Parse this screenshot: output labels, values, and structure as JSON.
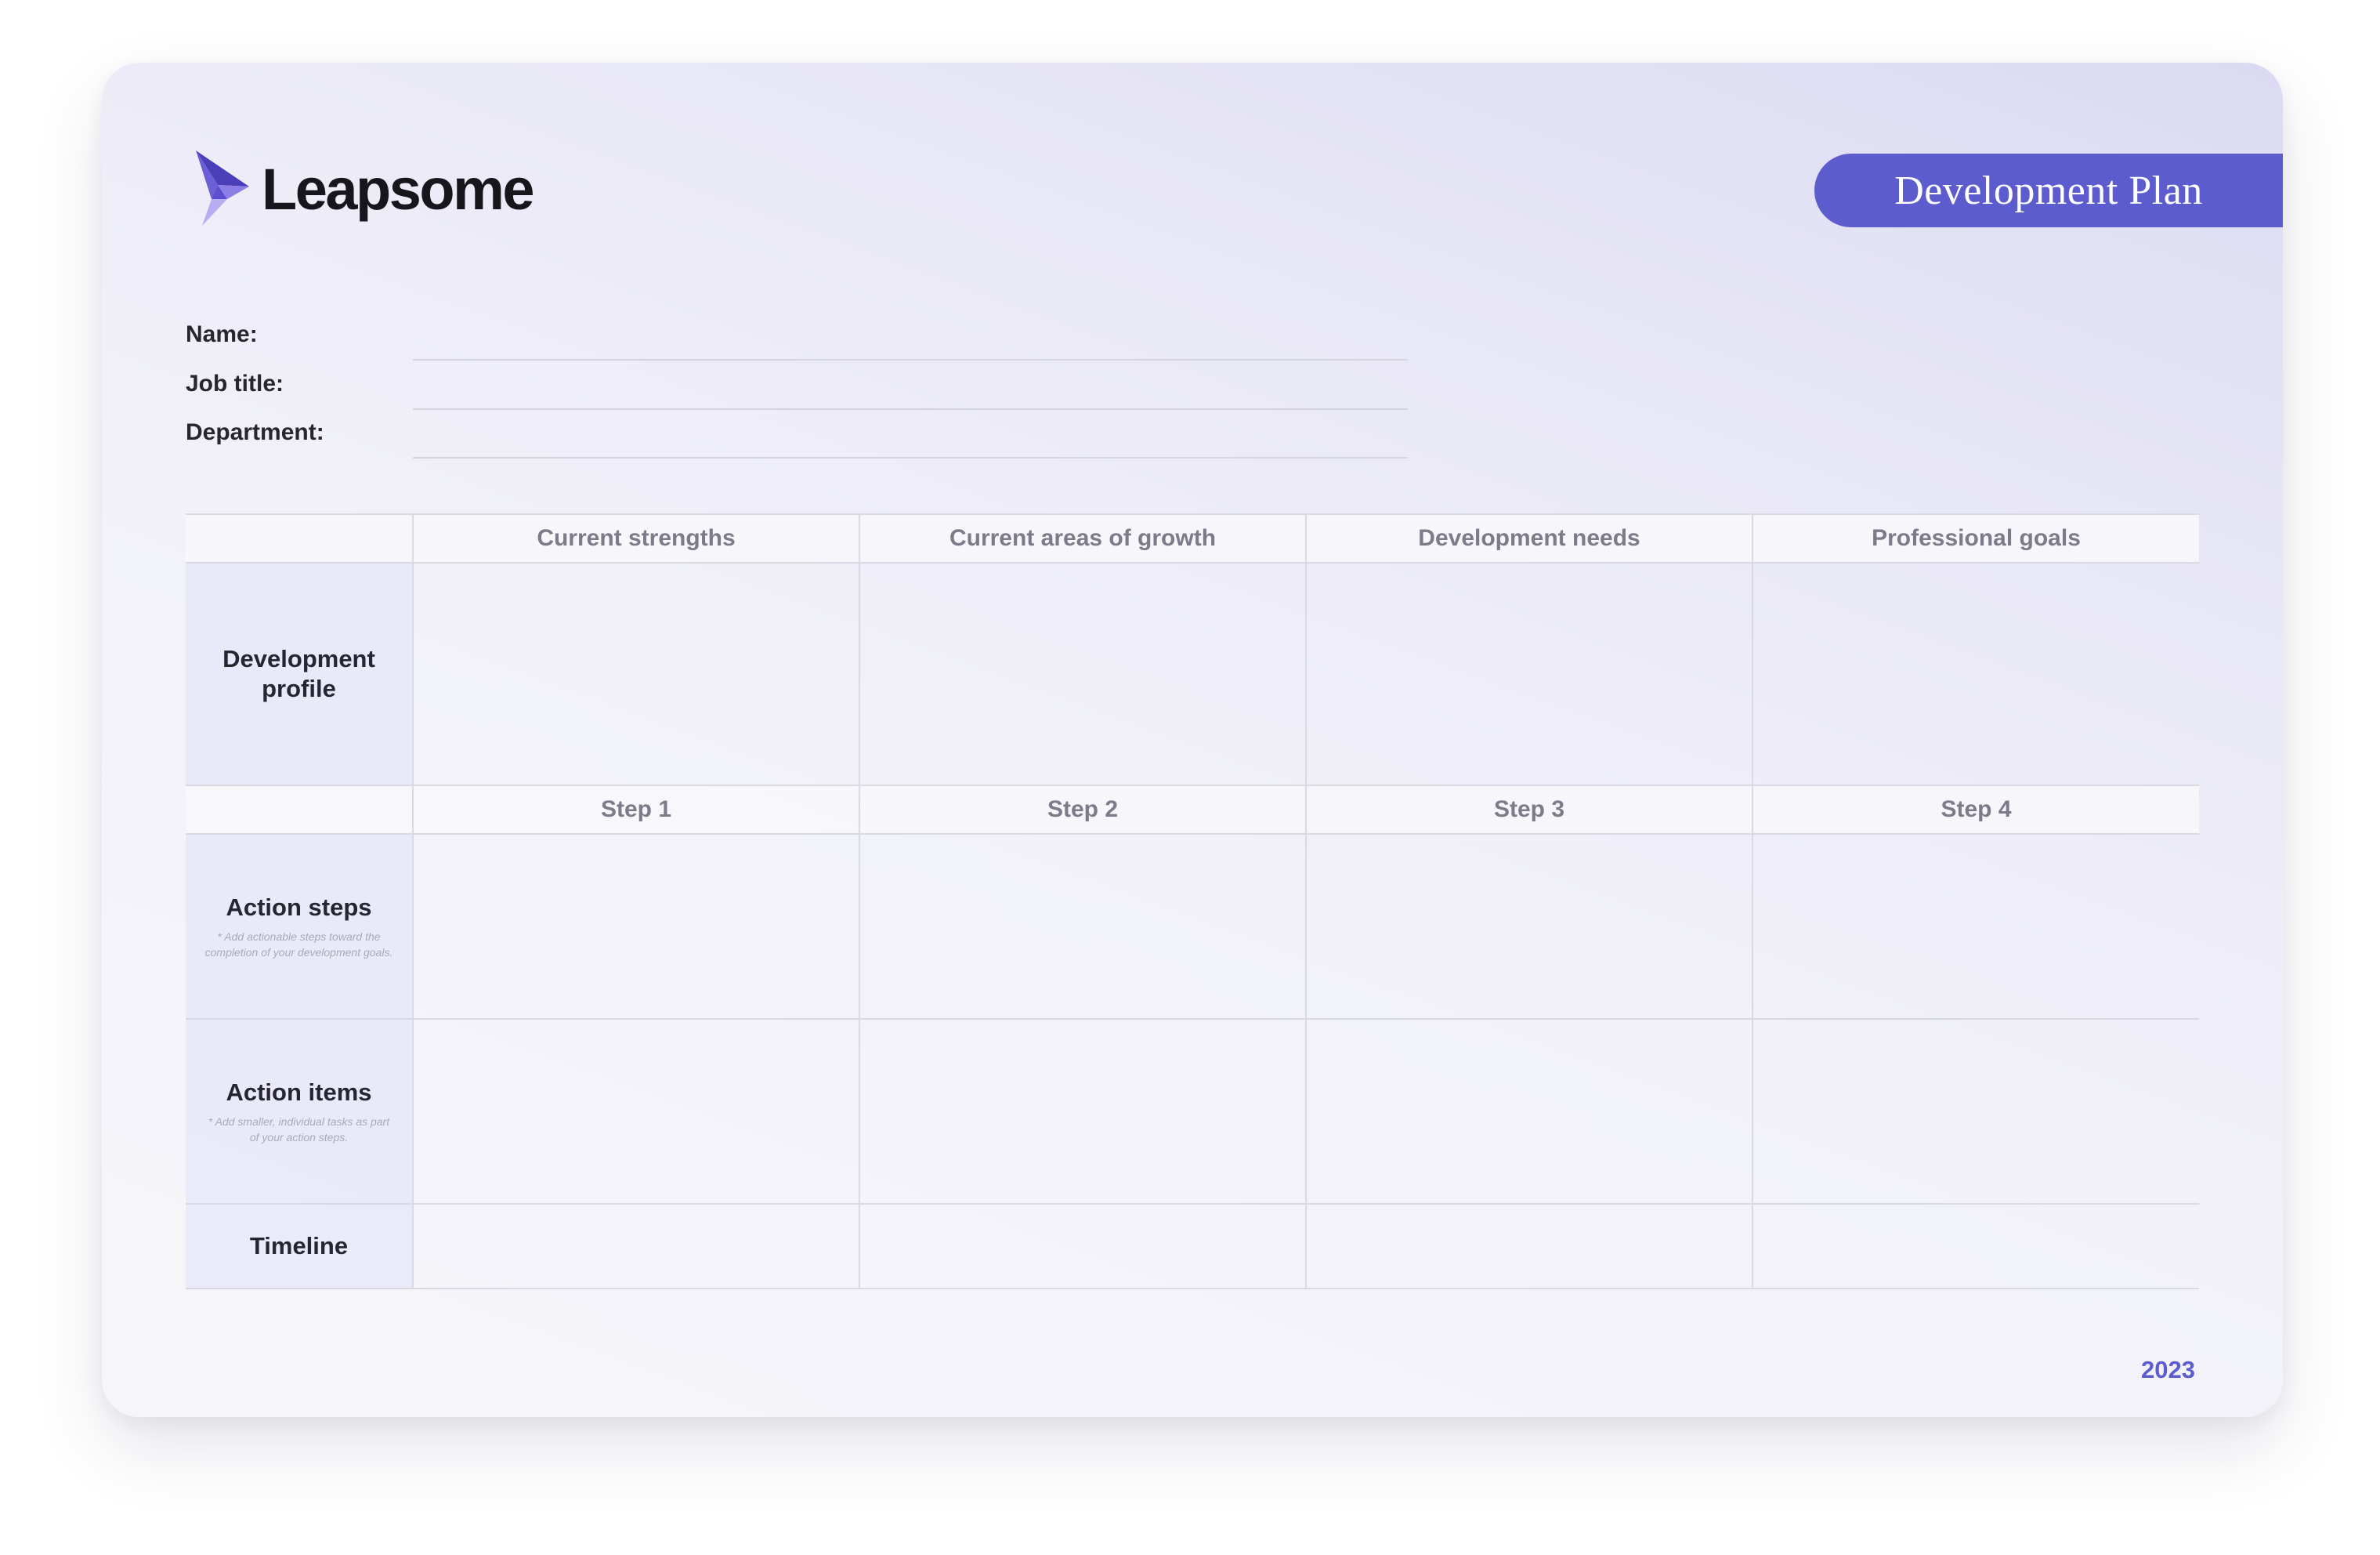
{
  "brand": {
    "name": "Leapsome",
    "logo_icon": "paper-plane-bird-icon",
    "accent_color": "#5c5ccf"
  },
  "title": "Development Plan",
  "fields": [
    {
      "label": "Name:",
      "value": ""
    },
    {
      "label": "Job title:",
      "value": ""
    },
    {
      "label": "Department:",
      "value": ""
    }
  ],
  "table": {
    "profile_headers": [
      "Current strengths",
      "Current areas of growth",
      "Development needs",
      "Professional goals"
    ],
    "step_headers": [
      "Step 1",
      "Step 2",
      "Step 3",
      "Step 4"
    ],
    "rows": {
      "development_profile": {
        "title": "Development profile"
      },
      "action_steps": {
        "title": "Action steps",
        "note": "* Add actionable steps toward the completion of your development goals."
      },
      "action_items": {
        "title": "Action items",
        "note": "* Add smaller, individual tasks as part of your action steps."
      },
      "timeline": {
        "title": "Timeline"
      }
    }
  },
  "year": "2023"
}
